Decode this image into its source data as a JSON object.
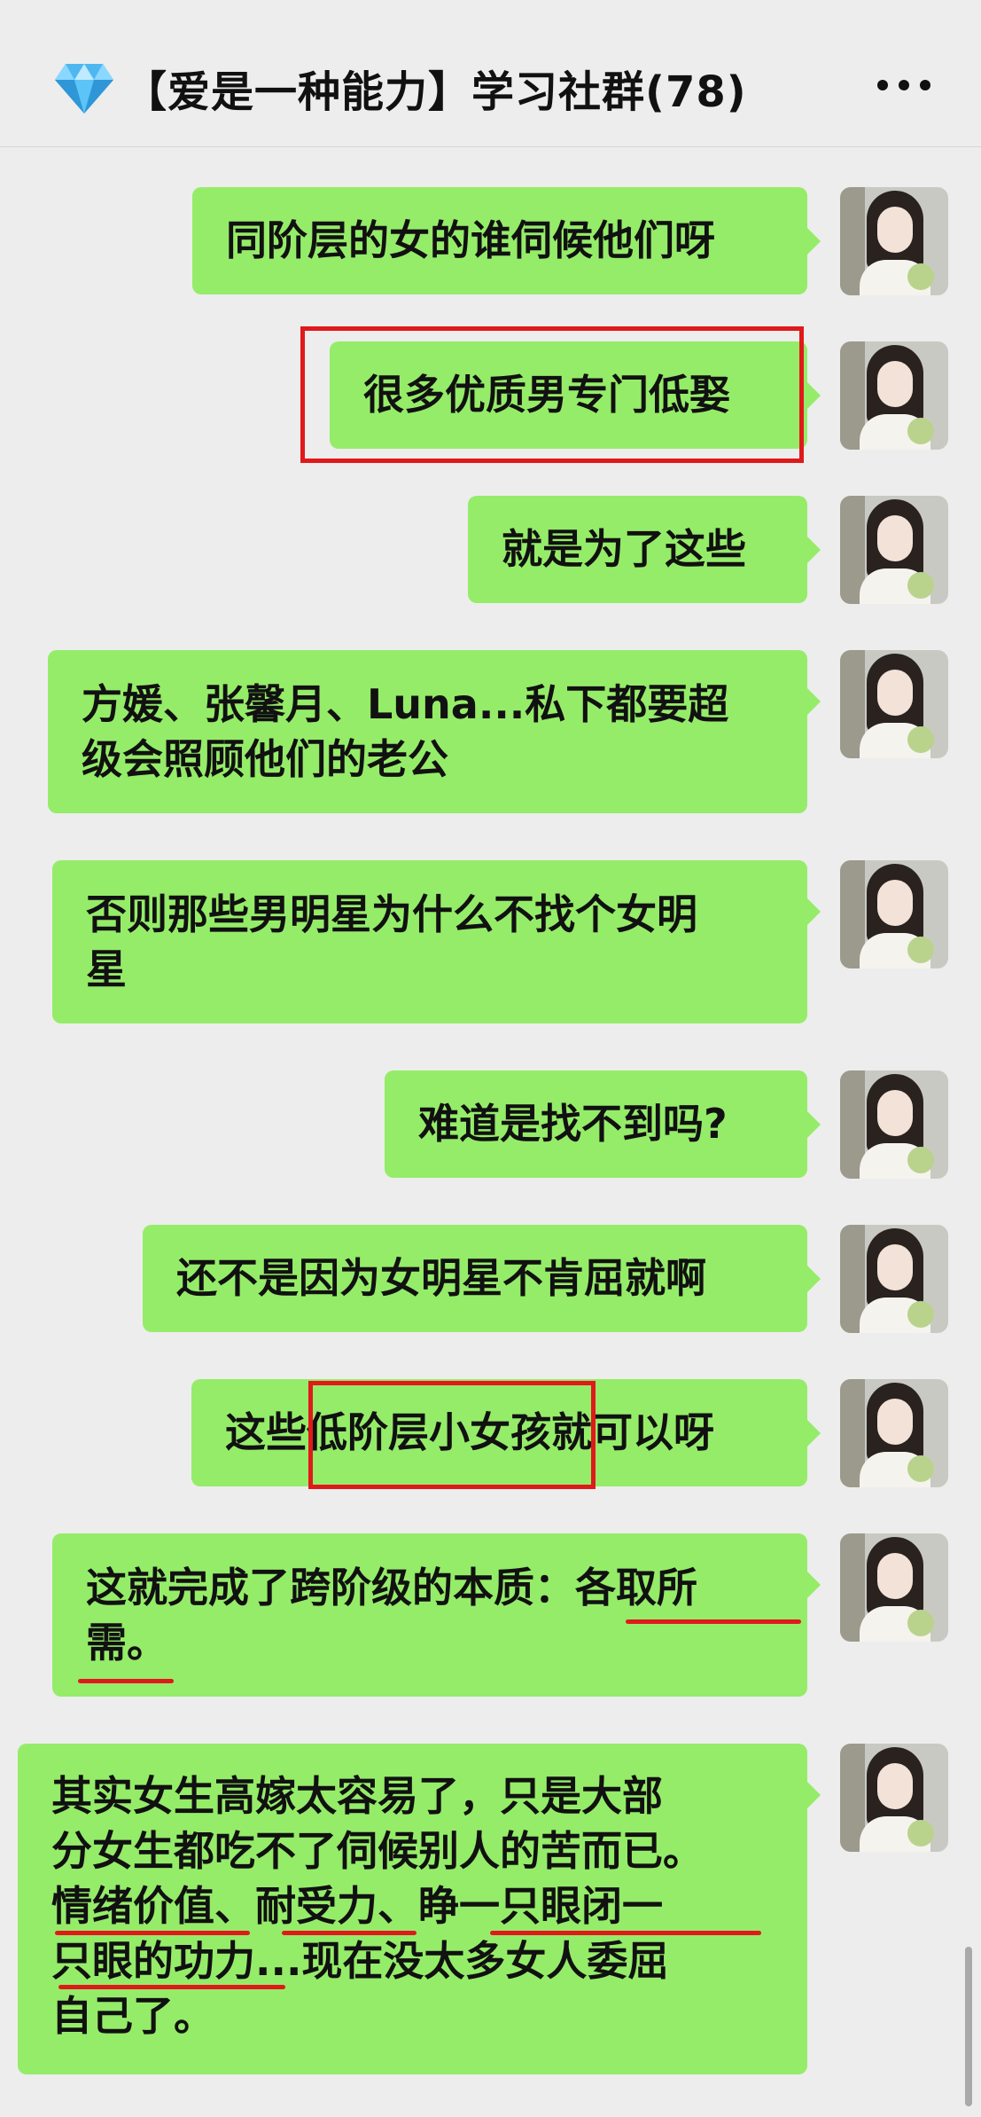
{
  "header": {
    "group_icon": "diamond-icon",
    "title": "【爱是一种能力】学习社群(78)",
    "more_icon": "more-dots-icon"
  },
  "messages": [
    {
      "lines": [
        "同阶层的女的谁伺候他们呀"
      ]
    },
    {
      "lines": [
        "很多优质男专门低娶"
      ]
    },
    {
      "lines": [
        "就是为了这些"
      ]
    },
    {
      "lines": [
        "方媛、张馨月、Luna...私下都要超",
        "级会照顾他们的老公"
      ]
    },
    {
      "lines": [
        "否则那些男明星为什么不找个女明",
        "星"
      ]
    },
    {
      "lines": [
        "难道是找不到吗?"
      ]
    },
    {
      "lines": [
        "还不是因为女明星不肯屈就啊"
      ]
    },
    {
      "lines": [
        "这些低阶层小女孩就可以呀"
      ]
    },
    {
      "lines": [
        "这就完成了跨阶级的本质：各取所",
        "需。"
      ]
    },
    {
      "lines": [
        "其实女生高嫁太容易了，只是大部",
        "分女生都吃不了伺候别人的苦而已。",
        "情绪价值、耐受力、睁一只眼闭一",
        "只眼的功力...现在没太多女人委屈",
        "自己了。"
      ]
    }
  ],
  "colors": {
    "bubble": "#95ec69",
    "background": "#ededed",
    "annotation": "#e0191b"
  }
}
